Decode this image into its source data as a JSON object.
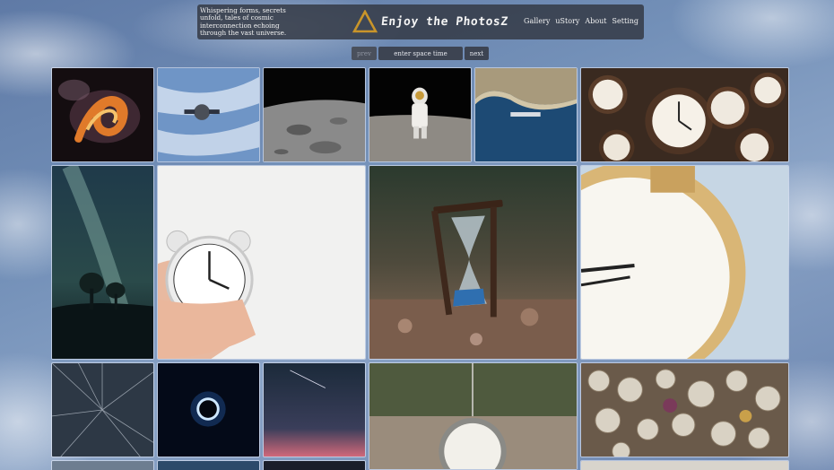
{
  "header": {
    "tagline": "Whispering forms, secrets unfold, tales of cosmic interconnection echoing through the vast universe.",
    "title": "Enjoy the PhotosZ",
    "logo_icon": "triangle-logo-icon",
    "nav": [
      {
        "label": "Gallery"
      },
      {
        "label": "uStory"
      },
      {
        "label": "About"
      },
      {
        "label": "Setting"
      }
    ]
  },
  "controls": {
    "prev_label": "prev",
    "input_placeholder": "enter space time",
    "next_label": "next"
  },
  "colors": {
    "header_bg": "#343a46",
    "button_bg": "#3d4452",
    "accent_gold": "#c9952a"
  }
}
